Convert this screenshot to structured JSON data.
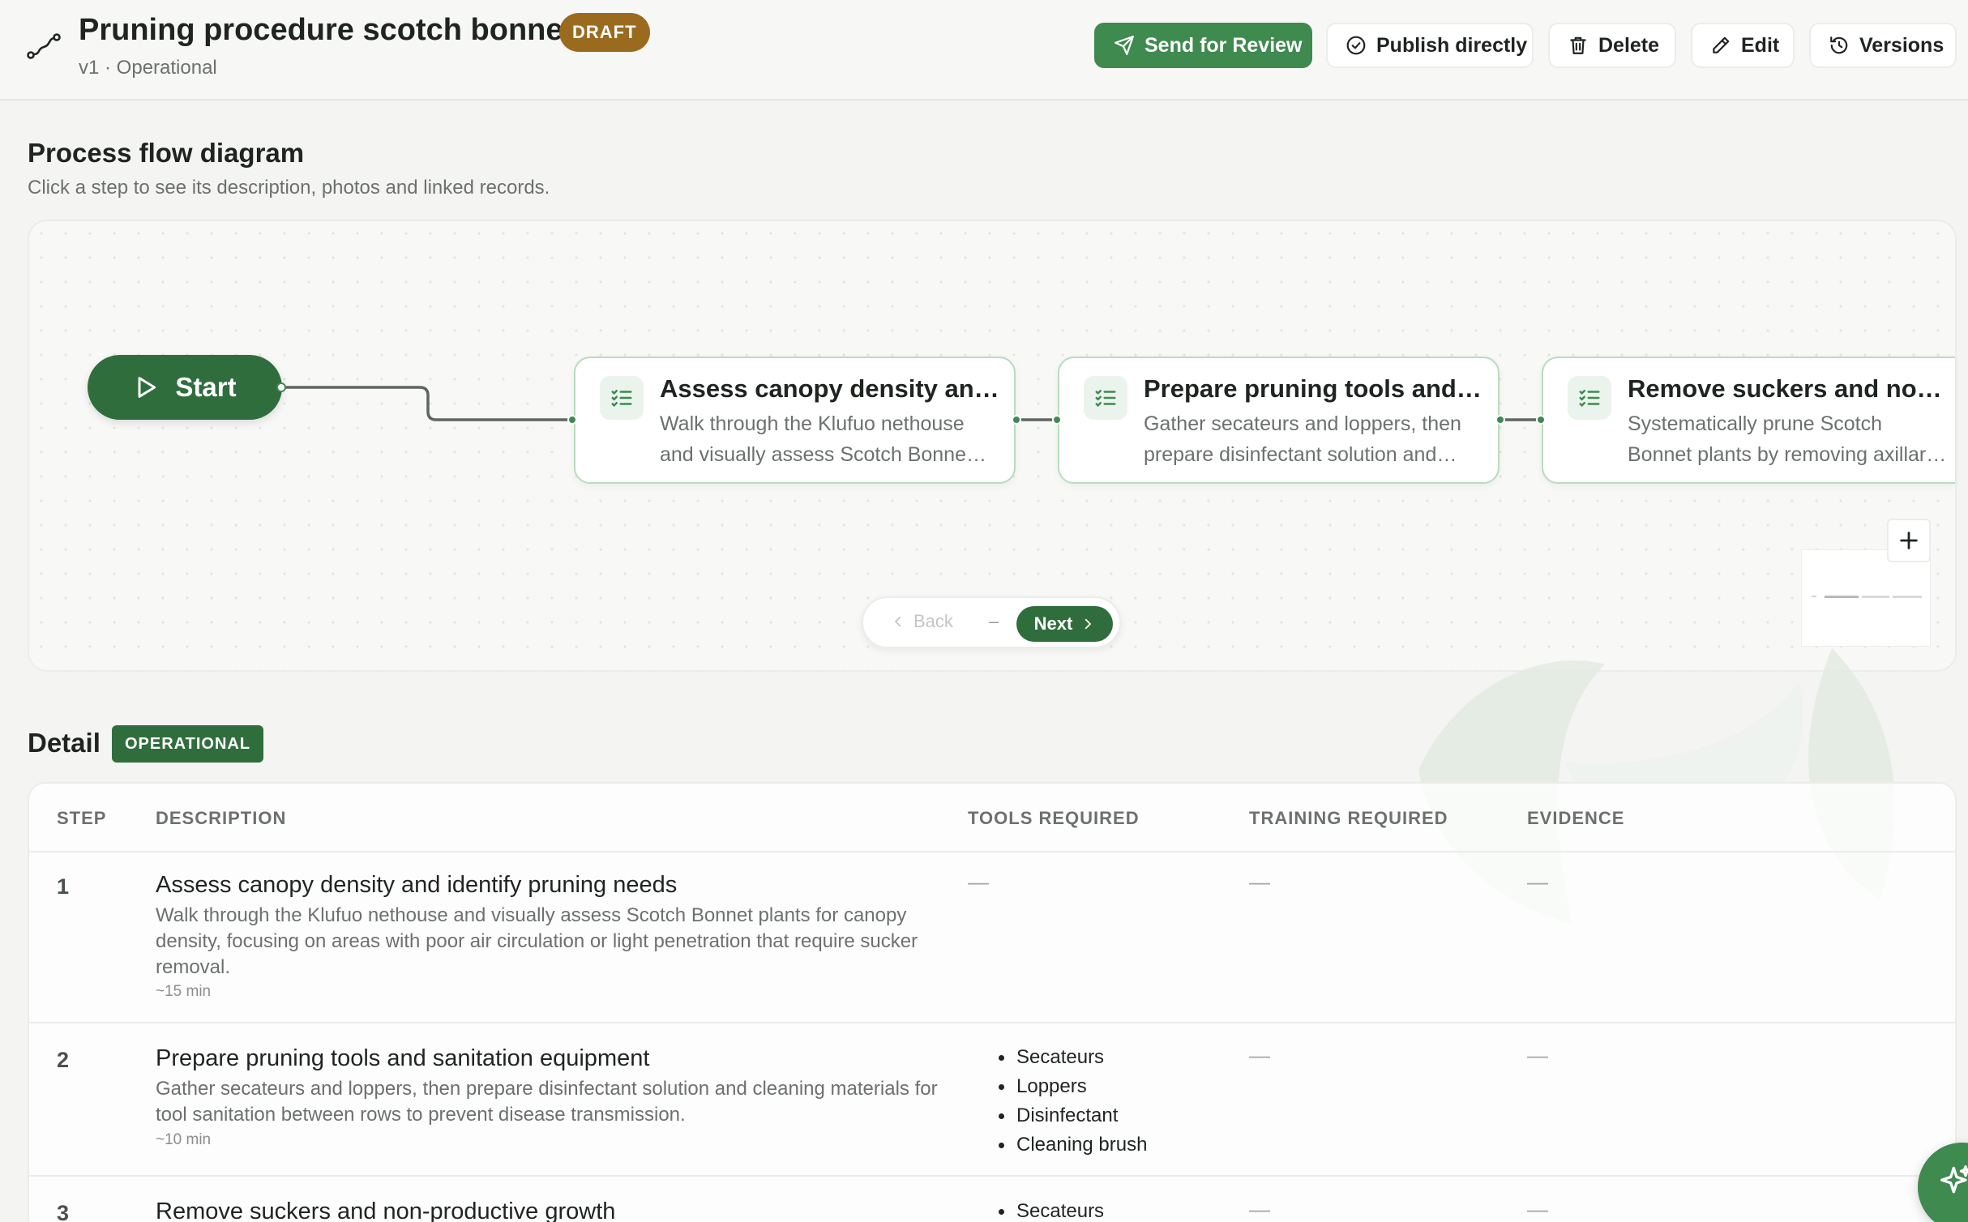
{
  "header": {
    "title": "Pruning procedure scotch bonnet",
    "status_badge": "DRAFT",
    "subtitle": "v1 · Operational",
    "actions": {
      "send_review": "Send for Review",
      "publish": "Publish directly",
      "delete": "Delete",
      "edit": "Edit",
      "versions": "Versions"
    }
  },
  "flow": {
    "title": "Process flow diagram",
    "subtitle": "Click a step to see its description, photos and linked records.",
    "start_label": "Start",
    "nodes": [
      {
        "title": "Assess canopy density an…",
        "desc": "Walk through the Klufuo nethouse and visually assess Scotch Bonne…"
      },
      {
        "title": "Prepare pruning tools and …",
        "desc": "Gather secateurs and loppers, then prepare disinfectant solution and…"
      },
      {
        "title": "Remove suckers and non-…",
        "desc": "Systematically prune Scotch Bonnet plants by removing axillary shoots…"
      }
    ],
    "pager": {
      "back": "Back",
      "separator": "–",
      "next": "Next"
    }
  },
  "detail": {
    "title": "Detail",
    "badge": "OPERATIONAL",
    "columns": [
      "STEP",
      "DESCRIPTION",
      "TOOLS REQUIRED",
      "TRAINING REQUIRED",
      "EVIDENCE"
    ],
    "empty": "—",
    "rows": [
      {
        "step": "1",
        "title": "Assess canopy density and identify pruning needs",
        "desc": "Walk through the Klufuo nethouse and visually assess Scotch Bonnet plants for canopy density, focusing on areas with poor air circulation or light penetration that require sucker removal.",
        "time": "~15 min",
        "tools": []
      },
      {
        "step": "2",
        "title": "Prepare pruning tools and sanitation equipment",
        "desc": "Gather secateurs and loppers, then prepare disinfectant solution and cleaning materials for tool sanitation between rows to prevent disease transmission.",
        "time": "~10 min",
        "tools": [
          "Secateurs",
          "Loppers",
          "Disinfectant",
          "Cleaning brush"
        ]
      },
      {
        "step": "3",
        "title": "Remove suckers and non-productive growth",
        "tools": [
          "Secateurs"
        ]
      }
    ]
  },
  "colors": {
    "primary": "#3e8a4f",
    "primary_dark": "#2f6e3c",
    "draft": "#9a6a1f",
    "node_border": "#b9dcbf"
  }
}
